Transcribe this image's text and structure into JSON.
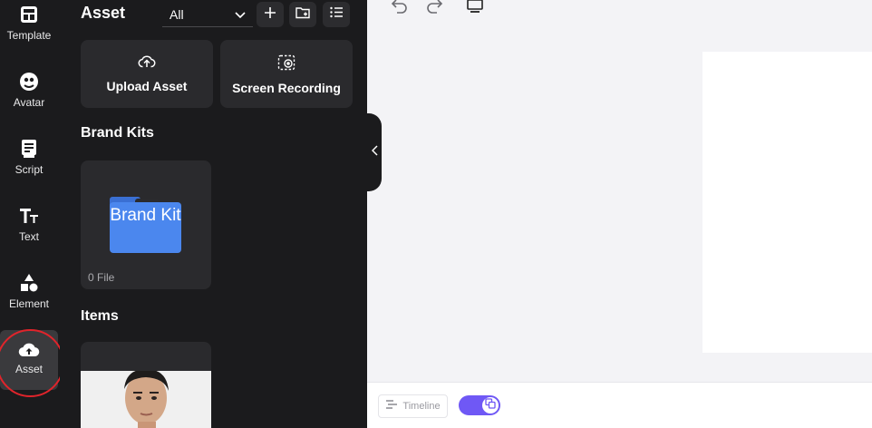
{
  "rail": {
    "items": [
      {
        "label": "Template"
      },
      {
        "label": "Avatar"
      },
      {
        "label": "Script"
      },
      {
        "label": "Text"
      },
      {
        "label": "Element"
      },
      {
        "label": "Asset"
      }
    ],
    "active": "Asset"
  },
  "panel": {
    "title": "Asset",
    "filter": {
      "selected": "All"
    },
    "upload_label": "Upload Asset",
    "record_label": "Screen Recording",
    "brand_kits_title": "Brand Kits",
    "brand_kit": {
      "folder_text": "Brand Kit",
      "file_count": "0 File"
    },
    "items_title": "Items"
  },
  "bottom": {
    "timeline_label": "Timeline",
    "toggle_on": true
  },
  "colors": {
    "accent": "#6f58f5",
    "folder_blue": "#4b87ee",
    "highlight_ring": "#e0242b",
    "panel_bg": "#1b1b1d",
    "workspace_bg": "#f3f3f6"
  }
}
